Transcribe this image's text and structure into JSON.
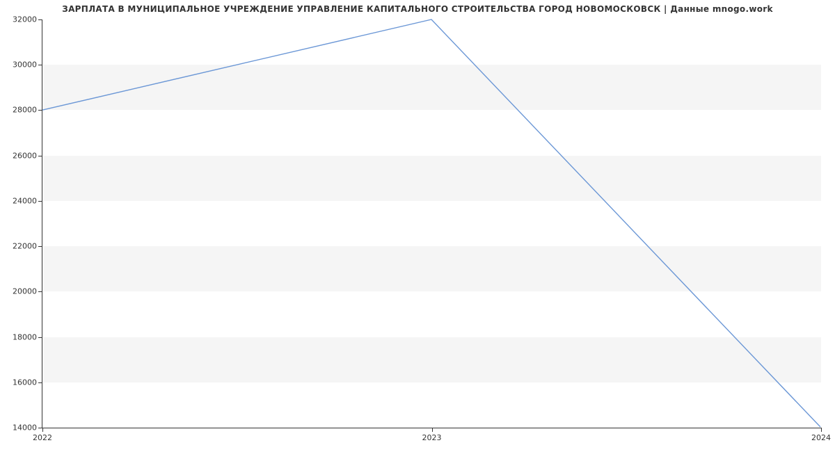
{
  "chart_data": {
    "type": "line",
    "title": "ЗАРПЛАТА В МУНИЦИПАЛЬНОЕ УЧРЕЖДЕНИЕ УПРАВЛЕНИЕ КАПИТАЛЬНОГО СТРОИТЕЛЬСТВА ГОРОД НОВОМОСКОВСК | Данные mnogo.work",
    "x": [
      2022,
      2023,
      2024
    ],
    "values": [
      28000,
      32000,
      14000
    ],
    "xlabel": "",
    "ylabel": "",
    "xlim": [
      2022,
      2024
    ],
    "ylim": [
      14000,
      32000
    ],
    "xticks": [
      2022,
      2023,
      2024
    ],
    "yticks": [
      14000,
      16000,
      18000,
      20000,
      22000,
      24000,
      26000,
      28000,
      30000,
      32000
    ],
    "xtick_labels": [
      "2022",
      "2023",
      "2024"
    ],
    "ytick_labels": [
      "14000",
      "16000",
      "18000",
      "20000",
      "22000",
      "24000",
      "26000",
      "28000",
      "30000",
      "32000"
    ],
    "line_color": "#6b97d6",
    "band_color": "#f5f5f5",
    "grid": "banded"
  }
}
